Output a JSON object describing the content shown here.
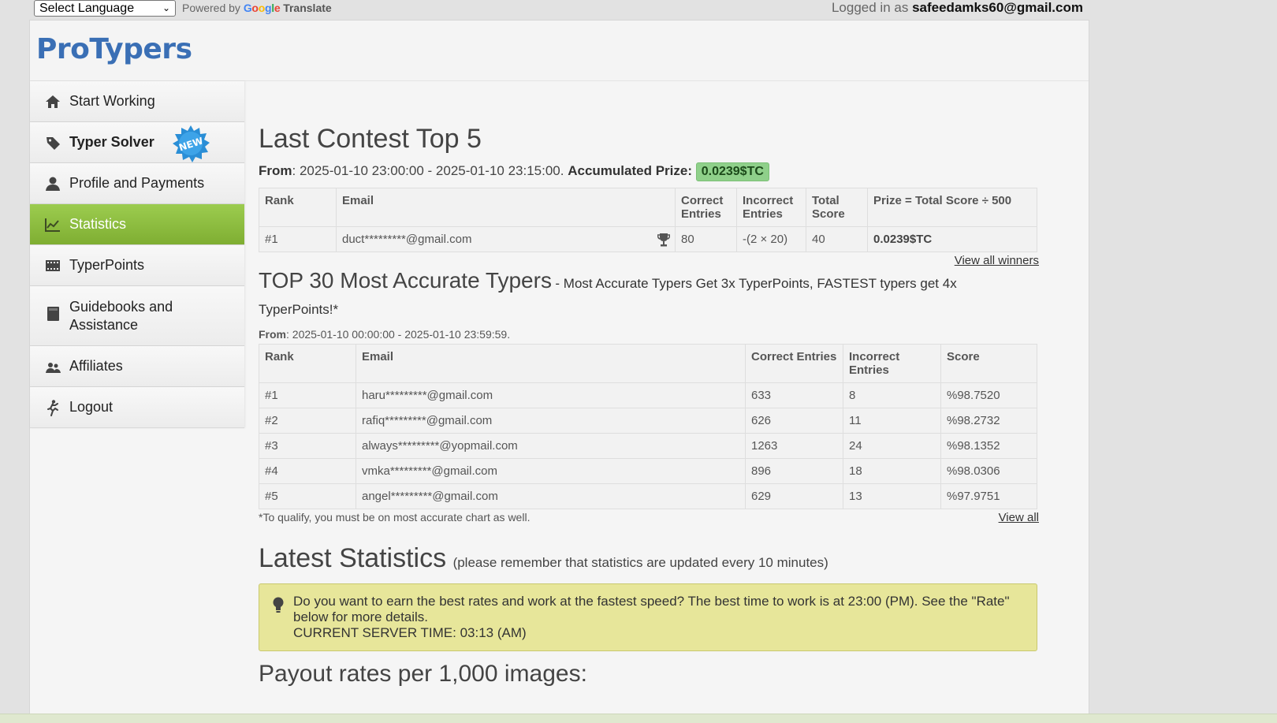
{
  "topbar": {
    "language_select": "Select Language",
    "powered_by": "Powered by",
    "google": [
      "G",
      "o",
      "o",
      "g",
      "l",
      "e"
    ],
    "translate": "Translate",
    "logged_in_as": "Logged in as",
    "user_email": "safeedamks60@gmail.com"
  },
  "brand": {
    "logo": "ProTypers"
  },
  "sidebar": {
    "items": [
      {
        "label": "Start Working",
        "icon": "home-icon"
      },
      {
        "label": "Typer Solver",
        "icon": "tag-icon",
        "badge": "NEW"
      },
      {
        "label": "Profile and Payments",
        "icon": "user-icon"
      },
      {
        "label": "Statistics",
        "icon": "chart-icon"
      },
      {
        "label": "TyperPoints",
        "icon": "film-icon"
      },
      {
        "label": "Guidebooks and Assistance",
        "icon": "book-icon"
      },
      {
        "label": "Affiliates",
        "icon": "users-icon"
      },
      {
        "label": "Logout",
        "icon": "logout-icon"
      }
    ]
  },
  "contest": {
    "title": "Last Contest Top 5",
    "from_label": "From",
    "from_range": ": 2025-01-10 23:00:00 - 2025-01-10 23:15:00.",
    "prize_label": "Accumulated Prize:",
    "prize_value": "0.0239$TC",
    "headers": [
      "Rank",
      "Email",
      "Correct Entries",
      "Incorrect Entries",
      "Total Score",
      "Prize = Total Score ÷ 500"
    ],
    "rows": [
      {
        "rank": "#1",
        "email": "duct*********@gmail.com",
        "correct": "80",
        "incorrect": "-(2 × 20)",
        "total": "40",
        "prize": "0.0239$TC"
      }
    ],
    "view_all_label": "View all winners"
  },
  "accurate": {
    "title": "TOP 30 Most Accurate Typers",
    "subtitle": "- Most Accurate Typers Get 3x TyperPoints, FASTEST typers get 4x TyperPoints!*",
    "from_label": "From",
    "from_range": ": 2025-01-10 00:00:00 - 2025-01-10 23:59:59.",
    "headers": [
      "Rank",
      "Email",
      "Correct Entries",
      "Incorrect Entries",
      "Score"
    ],
    "rows": [
      {
        "rank": "#1",
        "email": "haru*********@gmail.com",
        "correct": "633",
        "incorrect": "8",
        "score": "%98.7520"
      },
      {
        "rank": "#2",
        "email": "rafiq*********@gmail.com",
        "correct": "626",
        "incorrect": "11",
        "score": "%98.2732"
      },
      {
        "rank": "#3",
        "email": "always*********@yopmail.com",
        "correct": "1263",
        "incorrect": "24",
        "score": "%98.1352"
      },
      {
        "rank": "#4",
        "email": "vmka*********@gmail.com",
        "correct": "896",
        "incorrect": "18",
        "score": "%98.0306"
      },
      {
        "rank": "#5",
        "email": "angel*********@gmail.com",
        "correct": "629",
        "incorrect": "13",
        "score": "%97.9751"
      }
    ],
    "qualify_note": "*To qualify, you must be on most accurate chart as well.",
    "view_all_label": "View all"
  },
  "latest": {
    "title": "Latest Statistics",
    "note": "(please remember that statistics are updated every 10 minutes)",
    "alert_text": "Do you want to earn the best rates and work at the fastest speed? The best time to work is at 23:00 (PM). See the \"Rate\" below for more details.",
    "server_time": "CURRENT SERVER TIME: 03:13 (AM)"
  },
  "payout": {
    "title": "Payout rates per 1,000 images:"
  },
  "colors": {
    "accent_green": "#8dbd40",
    "brand_blue": "#3a6fb5",
    "alert_bg": "#e7e69a",
    "prize_bg": "#8fd08a"
  }
}
